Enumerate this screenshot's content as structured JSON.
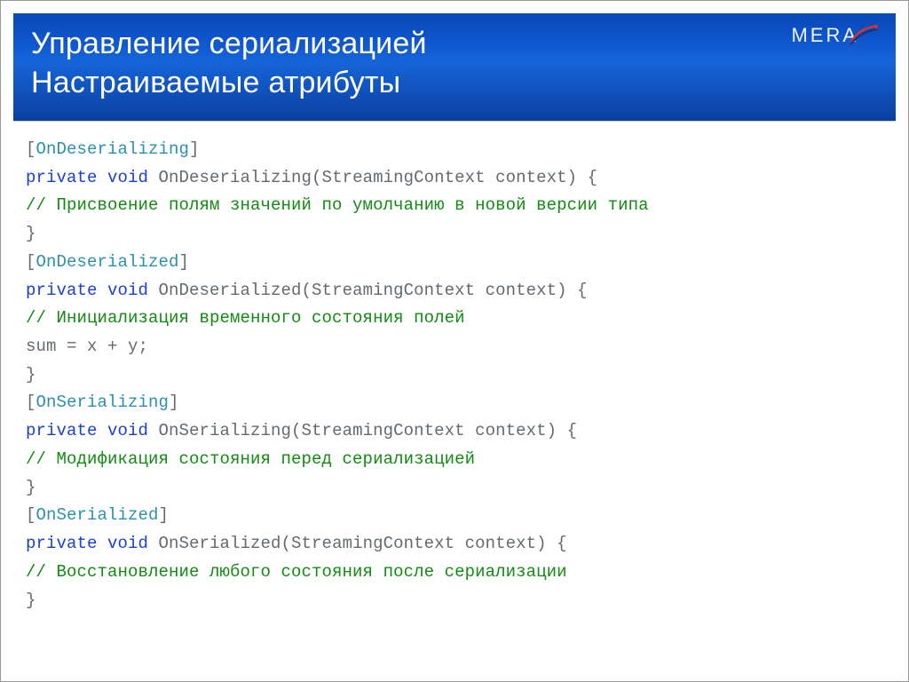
{
  "brand": {
    "logo_text": "MERA"
  },
  "title": {
    "line1": "Управление сериализацией",
    "line2": "Настраиваемые атрибуты"
  },
  "code": {
    "lines": [
      {
        "tokens": [
          {
            "cls": "tok-brack",
            "t": "["
          },
          {
            "cls": "tok-attr",
            "t": "OnDeserializing"
          },
          {
            "cls": "tok-brack",
            "t": "]"
          }
        ]
      },
      {
        "tokens": [
          {
            "cls": "tok-kw",
            "t": "private void "
          },
          {
            "cls": "tok-ident",
            "t": "OnDeserializing(StreamingContext context) {"
          }
        ]
      },
      {
        "tokens": [
          {
            "cls": "tok-comment",
            "t": "// Присвоение полям значений по умолчанию в новой версии типа"
          }
        ]
      },
      {
        "tokens": [
          {
            "cls": "tok-ident",
            "t": "}"
          }
        ]
      },
      {
        "tokens": [
          {
            "cls": "tok-brack",
            "t": "["
          },
          {
            "cls": "tok-attr",
            "t": "OnDeserialized"
          },
          {
            "cls": "tok-brack",
            "t": "]"
          }
        ]
      },
      {
        "tokens": [
          {
            "cls": "tok-kw",
            "t": "private void "
          },
          {
            "cls": "tok-ident",
            "t": "OnDeserialized(StreamingContext context) {"
          }
        ]
      },
      {
        "tokens": [
          {
            "cls": "tok-comment",
            "t": "// Инициализация временного состояния полей"
          }
        ]
      },
      {
        "tokens": [
          {
            "cls": "tok-ident",
            "t": "sum = x + y;"
          }
        ]
      },
      {
        "tokens": [
          {
            "cls": "tok-ident",
            "t": "}"
          }
        ]
      },
      {
        "tokens": [
          {
            "cls": "tok-brack",
            "t": "["
          },
          {
            "cls": "tok-attr",
            "t": "OnSerializing"
          },
          {
            "cls": "tok-brack",
            "t": "]"
          }
        ]
      },
      {
        "tokens": [
          {
            "cls": "tok-kw",
            "t": "private void "
          },
          {
            "cls": "tok-ident",
            "t": "OnSerializing(StreamingContext context) {"
          }
        ]
      },
      {
        "tokens": [
          {
            "cls": "tok-comment",
            "t": "// Модификация состояния перед сериализацией"
          }
        ]
      },
      {
        "tokens": [
          {
            "cls": "tok-ident",
            "t": "}"
          }
        ]
      },
      {
        "tokens": [
          {
            "cls": "tok-brack",
            "t": "["
          },
          {
            "cls": "tok-attr",
            "t": "OnSerialized"
          },
          {
            "cls": "tok-brack",
            "t": "]"
          }
        ]
      },
      {
        "tokens": [
          {
            "cls": "tok-kw",
            "t": "private void "
          },
          {
            "cls": "tok-ident",
            "t": "OnSerialized(StreamingContext context) {"
          }
        ]
      },
      {
        "tokens": [
          {
            "cls": "tok-comment",
            "t": "// Восстановление любого состояния после сериализации"
          }
        ]
      },
      {
        "tokens": [
          {
            "cls": "tok-ident",
            "t": "}"
          }
        ]
      }
    ]
  }
}
